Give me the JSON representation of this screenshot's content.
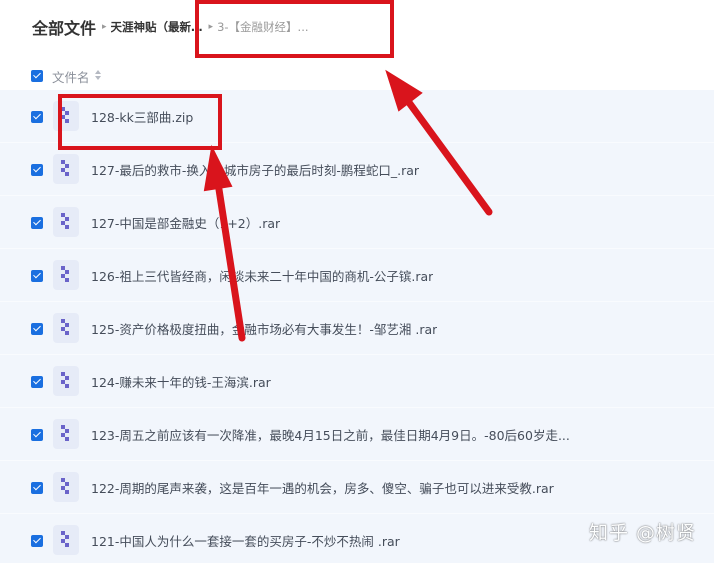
{
  "breadcrumb": {
    "root": "全部文件",
    "separator": "▸",
    "middle": "天涯神贴（最新...",
    "last": "3-【金融财经】..."
  },
  "header": {
    "column_label": "文件名"
  },
  "files": [
    {
      "name": "128-kk三部曲.zip"
    },
    {
      "name": "127-最后的救市-换入大城市房子的最后时刻-鹏程蛇口_.rar"
    },
    {
      "name": "127-中国是部金融史（1+2）.rar"
    },
    {
      "name": "126-祖上三代皆经商，闲谈未来二十年中国的商机-公子镔.rar"
    },
    {
      "name": "125-资产价格极度扭曲，金融市场必有大事发生！-邹艺湘 .rar"
    },
    {
      "name": "124-赚未来十年的钱-王海滨.rar"
    },
    {
      "name": "123-周五之前应该有一次降准，最晚4月15日之前，最佳日期4月9日。-80后60岁走..."
    },
    {
      "name": "122-周期的尾声来袭，这是百年一遇的机会，房多、傻空、骗子也可以进来受教.rar"
    },
    {
      "name": "121-中国人为什么一套接一套的买房子-不炒不热闹 .rar"
    }
  ],
  "watermark": "知乎 @树贤",
  "colors": {
    "accent": "#1a6fe0",
    "row_bg": "#f2f6fc",
    "annotation_red": "#d9141c",
    "file_icon": "#6a63c9"
  },
  "icons": {
    "checkbox": "checkbox-checked-icon",
    "sort": "sort-icon",
    "file": "archive-file-icon"
  }
}
